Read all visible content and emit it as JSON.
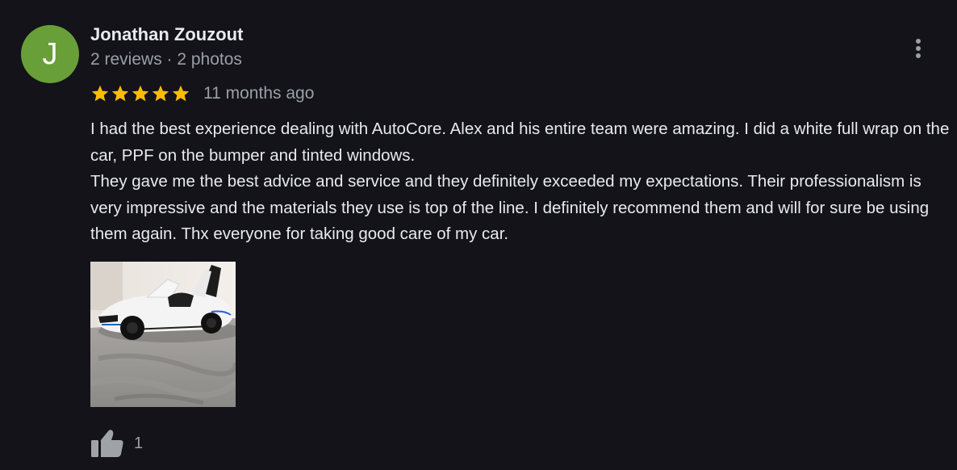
{
  "review": {
    "author": {
      "initial": "J",
      "name": "Jonathan Zouzout",
      "meta": "2 reviews · 2 photos",
      "avatar_color": "#689f38"
    },
    "rating": 5,
    "rating_max": 5,
    "star_color": "#fbbc04",
    "time": "11 months ago",
    "paragraphs": [
      "I had the best experience dealing with AutoCore. Alex and his entire team were amazing. I did a white full wrap on the car, PPF on the bumper and tinted windows.",
      "They gave me the best advice and service and they definitely exceeded my expectations. Their professionalism is very impressive and the materials they use is top of the line. I definitely recommend them and will for sure be using them again. Thx everyone for taking good care of my car."
    ],
    "photo_icon": "car-photo",
    "likes": "1"
  },
  "icons": {
    "more": "more-vert-icon",
    "like": "thumbs-up-icon",
    "star": "star-icon"
  }
}
